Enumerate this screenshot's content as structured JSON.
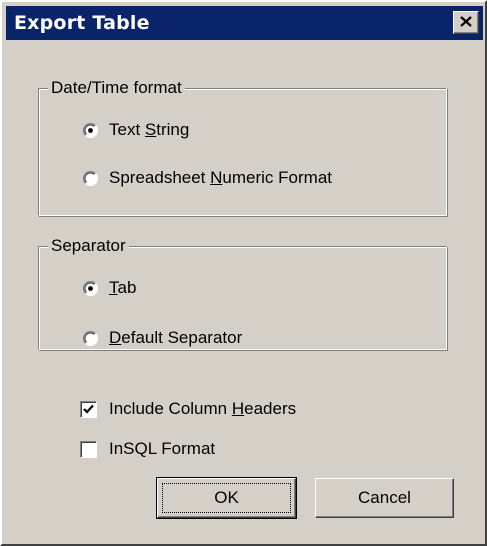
{
  "dialog": {
    "title": "Export Table"
  },
  "datetime_group": {
    "legend": "Date/Time format",
    "options": [
      {
        "pre": "Text ",
        "mnemonic": "S",
        "post": "tring",
        "selected": true
      },
      {
        "pre": "Spreadsheet ",
        "mnemonic": "N",
        "post": "umeric Format",
        "selected": false
      }
    ]
  },
  "separator_group": {
    "legend": "Separator",
    "options": [
      {
        "pre": "",
        "mnemonic": "T",
        "post": "ab",
        "selected": true
      },
      {
        "pre": "",
        "mnemonic": "D",
        "post": "efault Separator",
        "selected": false
      }
    ]
  },
  "checkboxes": [
    {
      "pre": "Include Column ",
      "mnemonic": "H",
      "post": "eaders",
      "checked": true
    },
    {
      "pre": "InSQL Format",
      "mnemonic": "",
      "post": "",
      "checked": false
    }
  ],
  "buttons": {
    "ok": "OK",
    "cancel": "Cancel"
  },
  "icons": {
    "close": "close-icon",
    "radio": "radio-button-icon",
    "checkbox": "checkbox-icon",
    "checkmark": "checkmark-icon"
  },
  "colors": {
    "dialog_face": "#d4d0c8",
    "titlebar": "#0a246a",
    "title_text": "#ffffff"
  }
}
